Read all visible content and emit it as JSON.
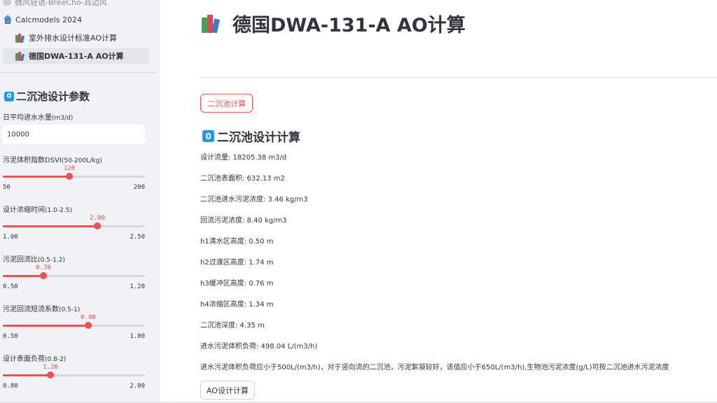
{
  "sidebar": {
    "nav": {
      "top_item": "微风轻语-BreeCho-耳边风",
      "app_name": "Calcmodels 2024",
      "items": [
        {
          "label": "室外排水设计标准AO计算"
        },
        {
          "label": "德国DWA-131-A AO计算"
        }
      ]
    },
    "section_title": "二沉池设计参数",
    "badge": "0",
    "inflow": {
      "label": "日平均进水水量",
      "unit": "(m3/d)",
      "value": "10000"
    },
    "sliders": [
      {
        "label": "污泥体积指数DSVI",
        "hint": "(50-200L/kg)",
        "value": "120",
        "min": "50",
        "max": "200",
        "fraction": 0.467
      },
      {
        "label": "设计浓缩时间",
        "hint": "(1.0-2.5)",
        "value": "2.00",
        "min": "1.00",
        "max": "2.50",
        "fraction": 0.667
      },
      {
        "label": "污泥回流比",
        "hint": "(0.5-1.2)",
        "value": "0.70",
        "min": "0.50",
        "max": "1.20",
        "fraction": 0.286
      },
      {
        "label": "污泥回流短流系数",
        "hint": "(0.5-1)",
        "value": "0.80",
        "min": "0.50",
        "max": "1.00",
        "fraction": 0.6
      },
      {
        "label": "设计表面负荷",
        "hint": "(0.8-2)",
        "value": "1.20",
        "min": "0.80",
        "max": "2.00",
        "fraction": 0.333
      }
    ]
  },
  "main": {
    "title": "德国DWA-131-A AO计算",
    "tab_button": "二沉池计算",
    "section_title": "二沉池设计计算",
    "badge": "0",
    "results": [
      "设计流量: 18205.38 m3/d",
      "二沉池表面积: 632.13 m2",
      "二沉池进水污泥浓度: 3.46 kg/m3",
      "回流污泥浓度: 8.40 kg/m3",
      "h1清水区高度: 0.50 m",
      "h2过渡区高度: 1.74 m",
      "h3缓冲区高度: 0.76 m",
      "h4浓缩区高度: 1.34 m",
      "二沉池深度: 4.35 m",
      "进水污泥体积负荷: 498.04 L/(m3/h)"
    ],
    "note": "进水污泥体积负荷应小于500L/(m3/h)，对于竖向流的二沉池，污泥絮凝较好，该值应小于650L/(m3/h),生物池污泥浓度(g/L)可按二沉池进水污泥浓度",
    "ao_button": "AO设计计算"
  },
  "colors": {
    "accent": "#ef5150",
    "sidebar_bg": "#f0f2f6",
    "badge_blue": "#1f9be6"
  },
  "icons": {
    "page": "books-icon",
    "app": "house-icon",
    "top": "chat-icon",
    "badge": "keycap-zero-icon"
  }
}
